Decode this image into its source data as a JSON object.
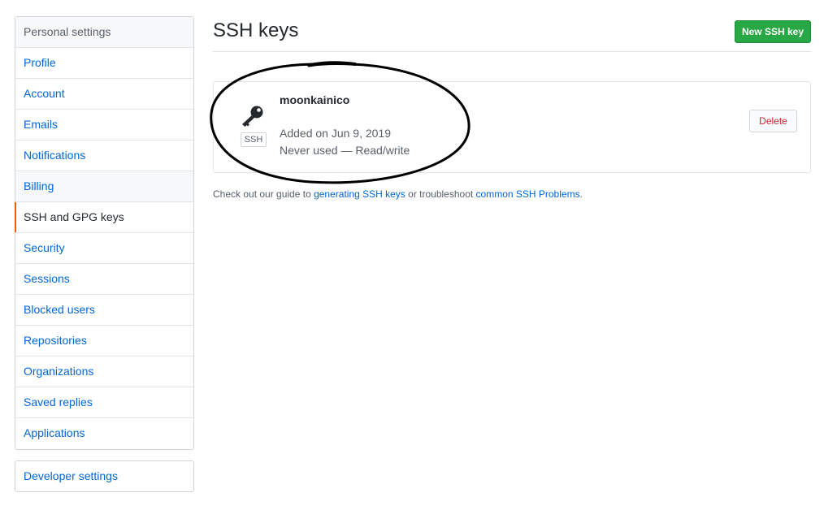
{
  "sidebar": {
    "heading": "Personal settings",
    "items": [
      {
        "label": "Profile"
      },
      {
        "label": "Account"
      },
      {
        "label": "Emails"
      },
      {
        "label": "Notifications"
      },
      {
        "label": "Billing"
      },
      {
        "label": "SSH and GPG keys",
        "selected": true
      },
      {
        "label": "Security"
      },
      {
        "label": "Sessions"
      },
      {
        "label": "Blocked users"
      },
      {
        "label": "Repositories"
      },
      {
        "label": "Organizations"
      },
      {
        "label": "Saved replies"
      },
      {
        "label": "Applications"
      }
    ],
    "developer_settings": "Developer settings"
  },
  "main": {
    "title": "SSH keys",
    "new_key_button": "New SSH key",
    "keys": [
      {
        "title": "moonkainico",
        "type_label": "SSH",
        "added": "Added on Jun 9, 2019",
        "usage": "Never used — Read/write",
        "delete_label": "Delete",
        "icon": "key-icon"
      }
    ],
    "help": {
      "prefix": "Check out our guide to ",
      "link1": "generating SSH keys",
      "middle": " or troubleshoot ",
      "link2": "common SSH Problems",
      "suffix": "."
    }
  },
  "colors": {
    "primary_button": "#28a745",
    "link": "#0366d6",
    "danger": "#cb2431",
    "selected_accent": "#e36209"
  }
}
